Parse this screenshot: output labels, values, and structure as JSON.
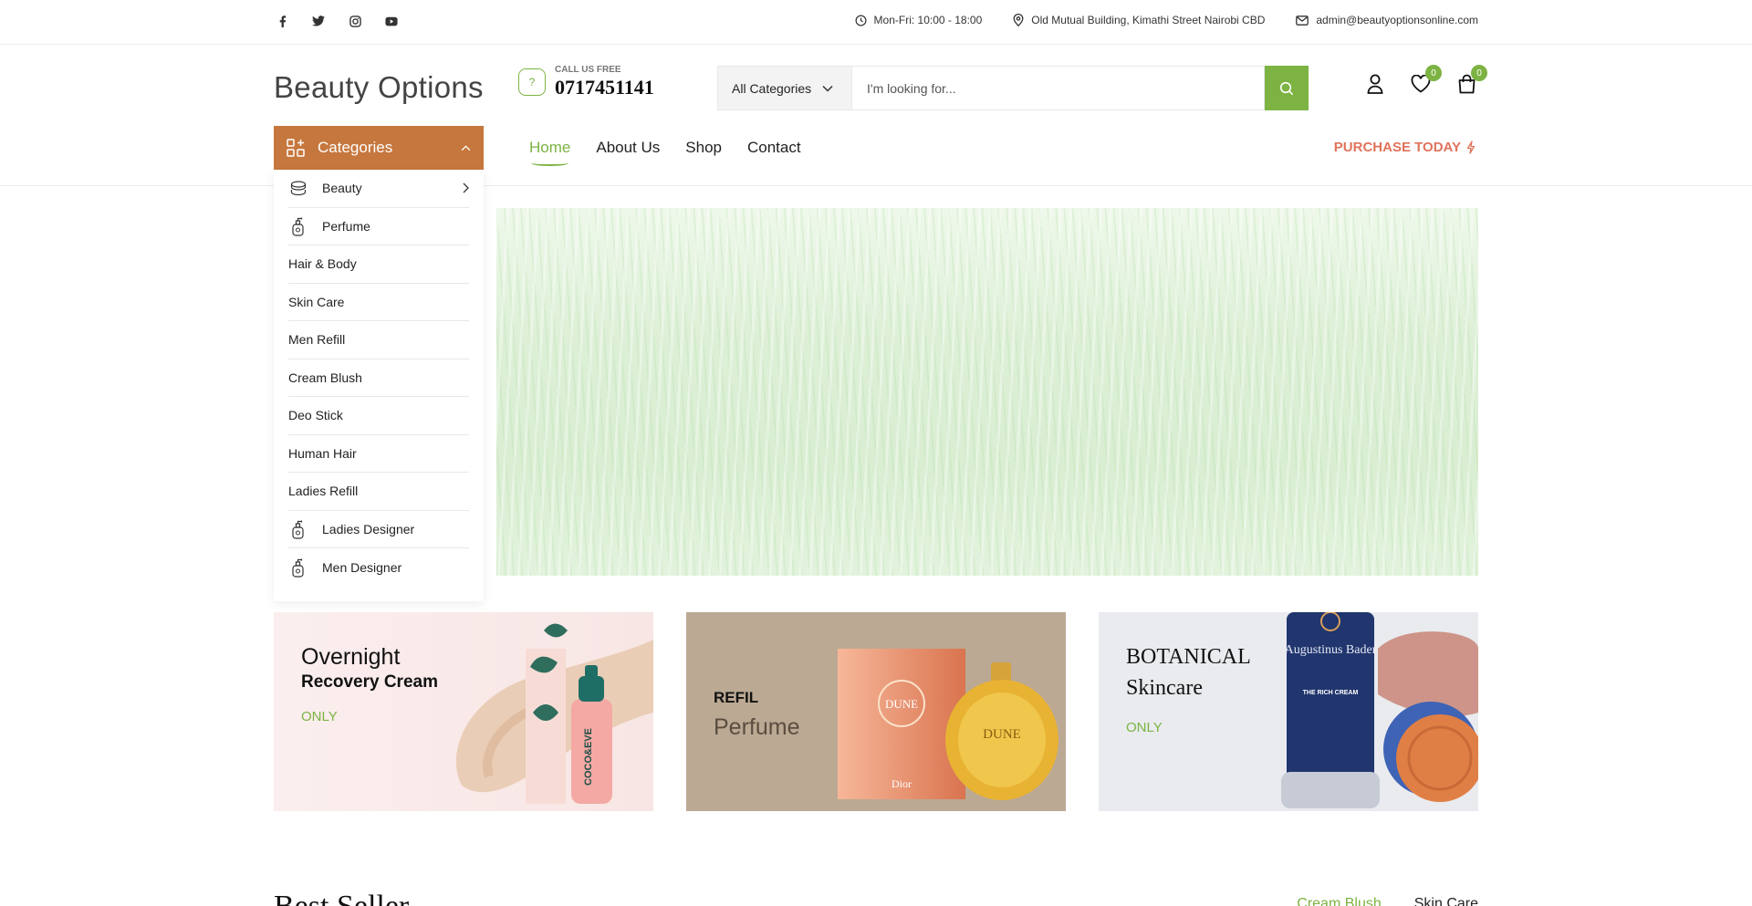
{
  "topbar": {
    "hours": "Mon-Fri: 10:00 - 18:00",
    "address": "Old Mutual Building, Kimathi Street Nairobi CBD",
    "email": "admin@beautyoptionsonline.com",
    "social": [
      "facebook-icon",
      "twitter-icon",
      "instagram-icon",
      "youtube-icon"
    ]
  },
  "header": {
    "logo": "Beauty Options",
    "call_label": "CALL US FREE",
    "phone": "0717451141",
    "search_category": "All Categories",
    "search_placeholder": "I'm looking for...",
    "wishlist_count": "0",
    "cart_count": "0"
  },
  "nav": {
    "categories_label": "Categories",
    "items": [
      "Home",
      "About Us",
      "Shop",
      "Contact"
    ],
    "purchase": "PURCHASE TODAY"
  },
  "categories": [
    {
      "label": "Beauty",
      "icon": "cosmetics-icon"
    },
    {
      "label": "Perfume",
      "icon": "perfume-icon"
    },
    {
      "label": "Hair & Body"
    },
    {
      "label": "Skin Care"
    },
    {
      "label": "Men Refill"
    },
    {
      "label": "Cream Blush"
    },
    {
      "label": "Deo Stick"
    },
    {
      "label": "Human Hair"
    },
    {
      "label": "Ladies Refill"
    },
    {
      "label": "Ladies Designer",
      "icon": "perfume-icon"
    },
    {
      "label": "Men Designer",
      "icon": "perfume-icon"
    }
  ],
  "banners": [
    {
      "title": "Overnight",
      "subtitle": "Recovery Cream",
      "tag": "ONLY",
      "product_text": "COCO&EVE"
    },
    {
      "title": "REFIL",
      "subtitle": "Perfume",
      "product_text": "DUNE",
      "brand_text": "Dior"
    },
    {
      "title": "BOTANICAL",
      "subtitle": "Skincare",
      "tag": "ONLY",
      "product_text": "Augustinus Bader",
      "product_sub": "THE RICH CREAM"
    }
  ],
  "section": {
    "title": "Best Seller",
    "tabs": [
      "Cream Blush",
      "Skin Care"
    ]
  },
  "colors": {
    "accent": "#7cb342",
    "categories_bg": "#c6773d",
    "purchase": "#e0735b"
  }
}
